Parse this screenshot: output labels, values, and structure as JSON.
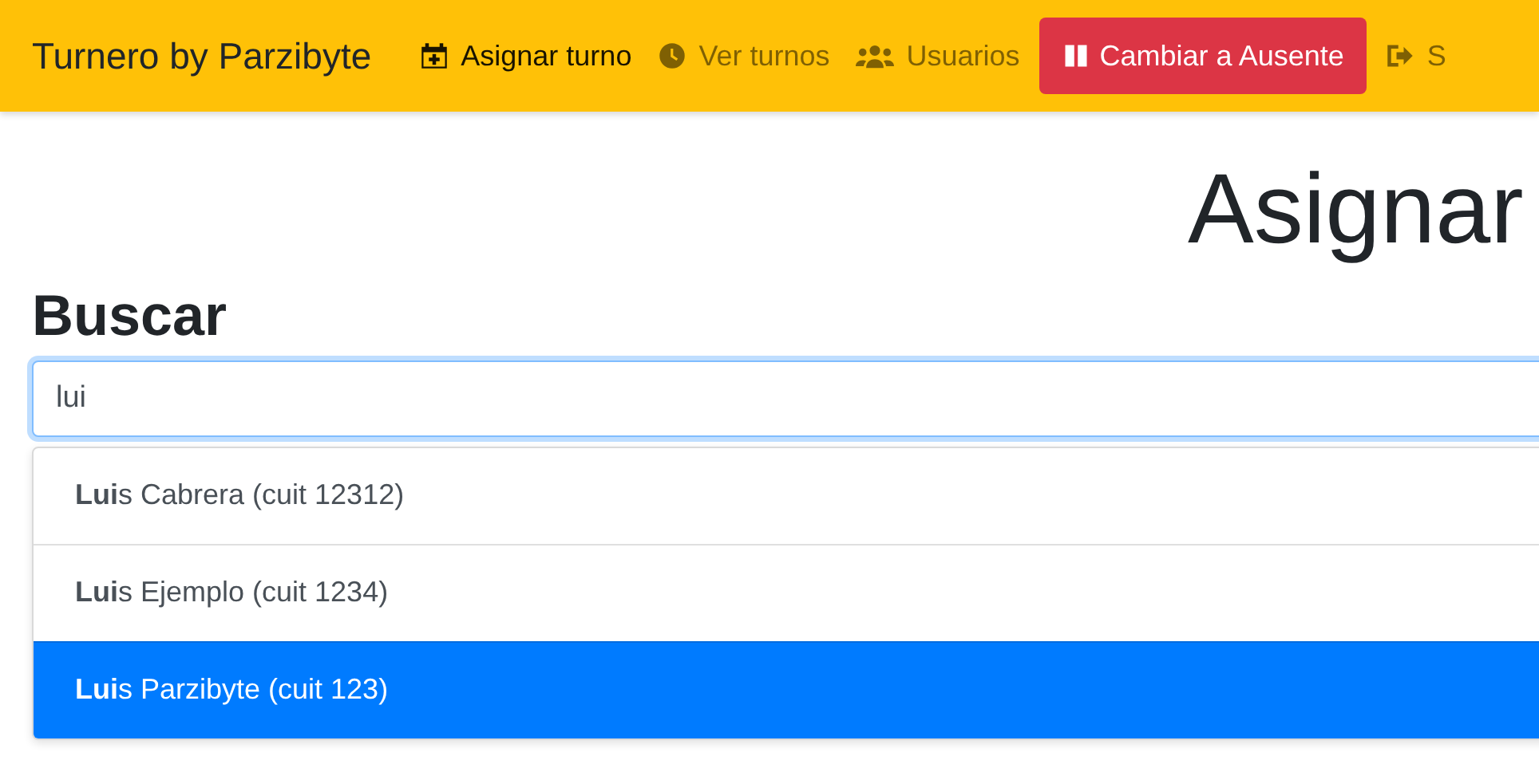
{
  "navbar": {
    "brand": "Turnero by Parzibyte",
    "items": [
      {
        "kind": "link",
        "label": "Asignar turno",
        "selected": true
      },
      {
        "kind": "link",
        "label": "Ver turnos",
        "selected": false
      },
      {
        "kind": "link",
        "label": "Usuarios",
        "selected": false
      },
      {
        "kind": "button",
        "label": "Cambiar a Ausente"
      },
      {
        "kind": "link",
        "label": "S",
        "selected": false
      }
    ]
  },
  "page_title": "Asignar",
  "search": {
    "heading": "Buscar",
    "value": "lui",
    "results": [
      {
        "label": "**Lui**s Cabrera (cuit 12312)",
        "selected": false
      },
      {
        "label": "**Lui**s Ejemplo (cuit 1234)",
        "selected": false
      },
      {
        "label": "**Lui**s Parzibyte (cuit 123)",
        "selected": true
      }
    ]
  }
}
